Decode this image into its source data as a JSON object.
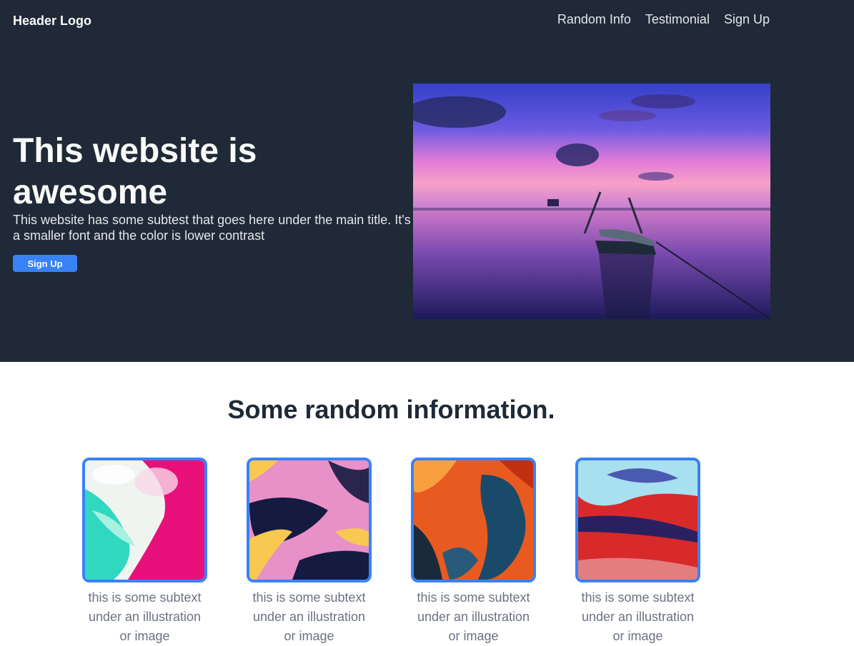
{
  "header": {
    "logo": "Header Logo",
    "nav": [
      "Random Info",
      "Testimonial",
      "Sign Up"
    ]
  },
  "hero": {
    "title": "This website is awesome",
    "subtext": "This website has some subtest that goes here under the main title. It's a smaller font and the color is lower contrast",
    "button": "Sign Up",
    "image": "sunset-boat-lake-photo"
  },
  "info": {
    "title": "Some random information.",
    "cards": [
      {
        "image": "teal-pink-marble-art",
        "text": "this is some subtext under an illustration or image"
      },
      {
        "image": "pink-navy-yellow-marble-art",
        "text": "this is some subtext under an illustration or image"
      },
      {
        "image": "orange-blue-fluid-art",
        "text": "this is some subtext under an illustration or image"
      },
      {
        "image": "red-blue-fluid-art",
        "text": "this is some subtext under an illustration or image"
      }
    ]
  },
  "colors": {
    "dark": "#1f2937",
    "accent": "#3882f6",
    "light_text": "#f9faf8",
    "muted_text": "#6b7280"
  }
}
